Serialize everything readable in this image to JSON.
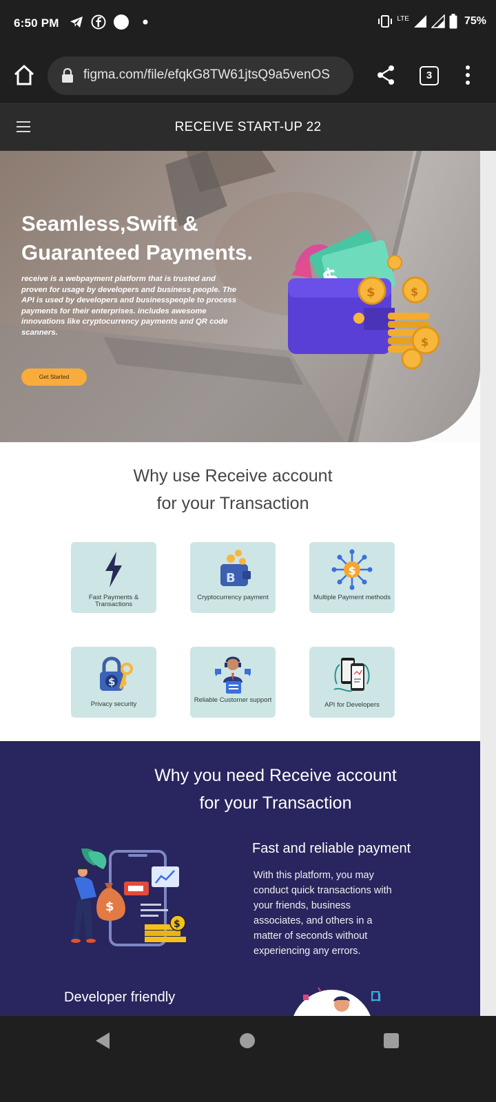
{
  "status_bar": {
    "time": "6:50 PM",
    "battery": "75%",
    "network": "LTE",
    "left_icons": [
      "telegram-icon",
      "facebook-icon",
      "circle-notification-icon",
      "dot-icon"
    ],
    "right_icons": [
      "vibrate-icon",
      "lte-icon",
      "signal-icon",
      "signal-icon-2",
      "battery-icon"
    ]
  },
  "browser": {
    "url": "figma.com/file/efqkG8TW61jtsQ9a5venOS",
    "tab_count": "3",
    "icons": [
      "home-icon",
      "lock-icon",
      "share-icon",
      "tabs-icon",
      "more-vert-icon"
    ]
  },
  "app_nav": {
    "title": "RECEIVE START-UP 22",
    "menu_icon": "hamburger-icon"
  },
  "hero": {
    "title_line1": "Seamless,Swift &",
    "title_line2": "Guaranteed Payments.",
    "description": "receive is a webpayment platform that is trusted and proven for usage by developers and business people. The API is used by developers and businesspeople to process payments for their enterprises. includes awesome innovations like cryptocurrency payments and QR code scanners.",
    "cta_label": "Get Started"
  },
  "why_use": {
    "title_line1": "Why use Receive account",
    "title_line2": "for your Transaction",
    "features": [
      {
        "label": "Fast Payments & Transactions",
        "icon": "lightning-icon"
      },
      {
        "label": "Cryptocurrency payment",
        "icon": "crypto-wallet-icon"
      },
      {
        "label": "Multiple Payment methods",
        "icon": "payment-network-icon"
      },
      {
        "label": "Privacy security",
        "icon": "padlock-key-icon"
      },
      {
        "label": "Reliable Customer support",
        "icon": "support-agent-icon"
      },
      {
        "label": "API for Developers",
        "icon": "phone-api-icon"
      }
    ]
  },
  "why_need": {
    "title_line1": "Why you need Receive account",
    "title_line2": "for your Transaction",
    "benefit_title": "Fast and reliable payment",
    "benefit_desc": "With this platform, you may conduct quick transactions with your friends, business associates, and others in a matter of seconds without experiencing any errors.",
    "dev_title": "Developer friendly"
  },
  "colors": {
    "accent": "#f7ac3b",
    "card_bg": "#cde5e5",
    "dark_section": "#29255e",
    "chrome": "#1f1f1f"
  },
  "android_nav": [
    "back-icon",
    "home-circle-icon",
    "recents-icon"
  ]
}
